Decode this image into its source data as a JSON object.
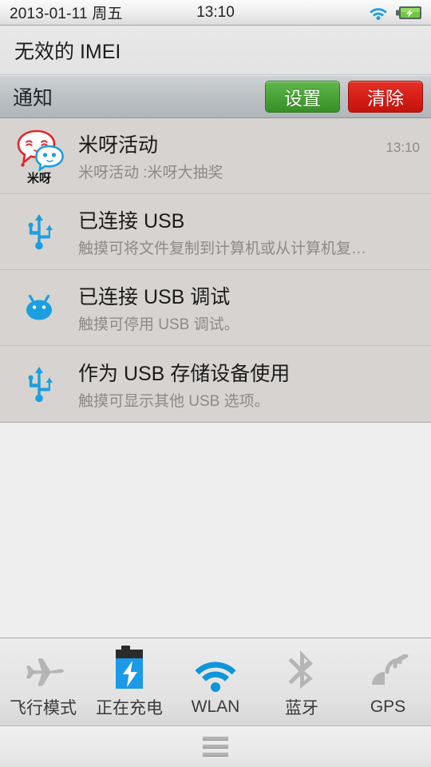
{
  "status_bar": {
    "date": "2013-01-11 周五",
    "clock": "13:10",
    "wifi_icon": "wifi-icon",
    "battery_icon": "battery-charging-icon",
    "wifi_color": "#1b9fe0",
    "battery_color": "#64c338"
  },
  "imei_banner": {
    "text": "无效的 IMEI"
  },
  "notif_header": {
    "title": "通知",
    "settings_label": "设置",
    "clear_label": "清除",
    "settings_color": "#4aa436",
    "clear_color": "#d61f17"
  },
  "notifications": [
    {
      "icon": "miya-logo-icon",
      "title": "米呀活动",
      "subtitle": "米呀活动 :米呀大抽奖",
      "time": "13:10",
      "logo_text": "米呀"
    },
    {
      "icon": "usb-icon",
      "title": "已连接 USB",
      "subtitle": "触摸可将文件复制到计算机或从计算机复…",
      "time": ""
    },
    {
      "icon": "android-debug-icon",
      "title": "已连接 USB 调试",
      "subtitle": "触摸可停用 USB 调试。",
      "time": ""
    },
    {
      "icon": "usb-icon",
      "title": "作为 USB 存储设备使用",
      "subtitle": "触摸可显示其他 USB 选项。",
      "time": ""
    }
  ],
  "toggles": [
    {
      "icon": "airplane-icon",
      "label": "飞行模式",
      "active": false,
      "color": "#b5b5b5"
    },
    {
      "icon": "battery-charging-icon",
      "label": "正在充电",
      "active": true,
      "color": "#1a9ae8"
    },
    {
      "icon": "wifi-icon",
      "label": "WLAN",
      "active": true,
      "color": "#0d96dc"
    },
    {
      "icon": "bluetooth-icon",
      "label": "蓝牙",
      "active": false,
      "color": "#b5b5b5"
    },
    {
      "icon": "gps-icon",
      "label": "GPS",
      "active": false,
      "color": "#b5b5b5"
    }
  ],
  "nav_bar": {
    "handle_icon": "drag-handle-icon"
  }
}
